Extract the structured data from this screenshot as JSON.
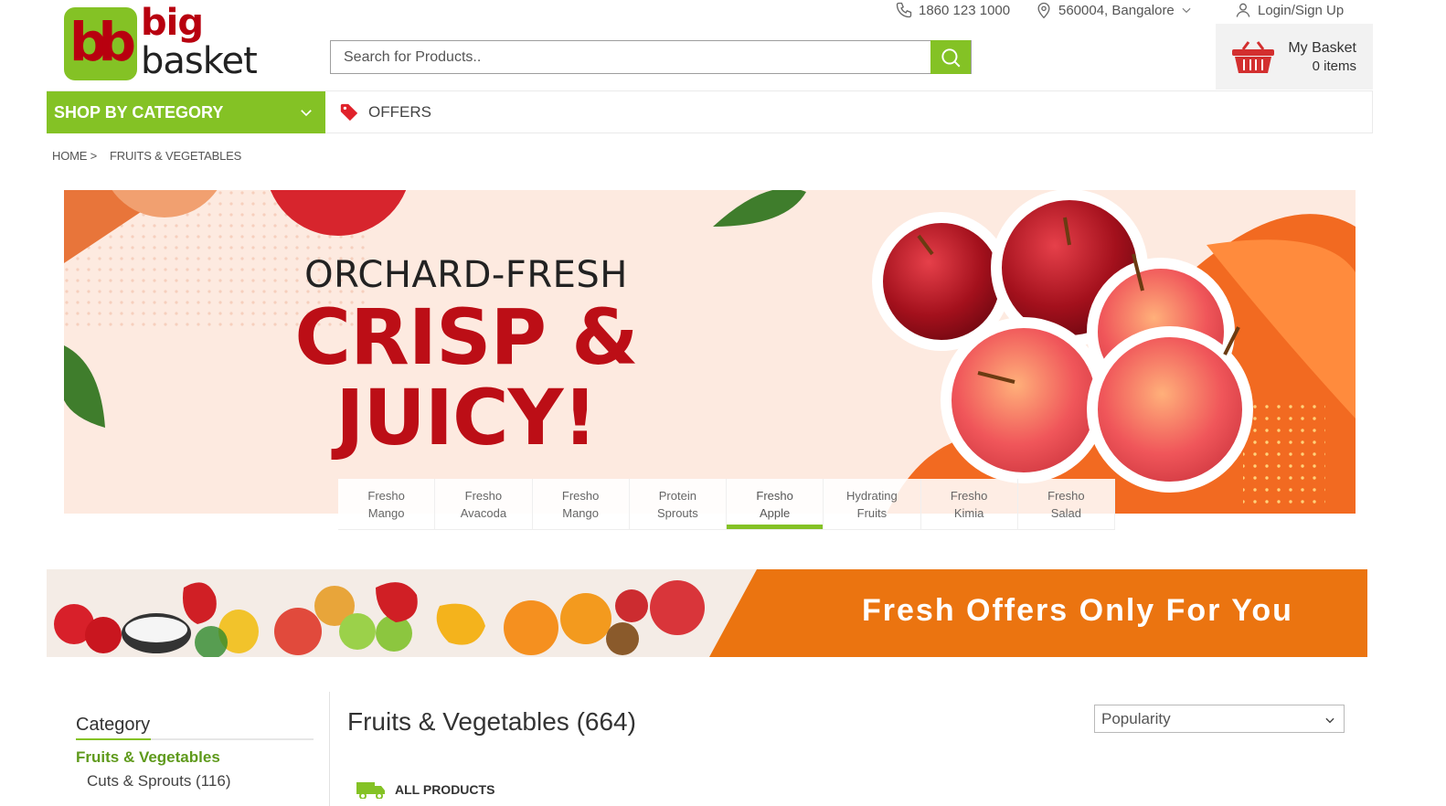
{
  "header": {
    "phone": "1860 123 1000",
    "location": "560004, Bangalore",
    "login": "Login/Sign Up",
    "logo_word1": "big",
    "logo_word2": "basket",
    "logo_mark": "bb",
    "search_placeholder": "Search for Products..",
    "basket_title": "My Basket",
    "basket_count": "0 items"
  },
  "nav": {
    "shop_by_category": "SHOP BY CATEGORY",
    "offers": "OFFERS"
  },
  "breadcrumb": [
    "HOME >",
    "FRUITS & VEGETABLES"
  ],
  "hero": {
    "line1": "ORCHARD-FRESH",
    "line2": "CRISP &",
    "line3": "JUICY!",
    "tabs": [
      {
        "l1": "Fresho",
        "l2": "Mango"
      },
      {
        "l1": "Fresho",
        "l2": "Avacoda"
      },
      {
        "l1": "Fresho",
        "l2": "Mango"
      },
      {
        "l1": "Protein",
        "l2": "Sprouts"
      },
      {
        "l1": "Fresho",
        "l2": "Apple"
      },
      {
        "l1": "Hydrating",
        "l2": "Fruits"
      },
      {
        "l1": "Fresho",
        "l2": "Kimia"
      },
      {
        "l1": "Fresho",
        "l2": "Salad"
      }
    ],
    "active_tab": 4
  },
  "strip": {
    "text": "Fresh Offers Only For You"
  },
  "sidebar": {
    "title": "Category",
    "category": "Fruits & Vegetables",
    "subcategory": "Cuts & Sprouts (116)"
  },
  "listing": {
    "title": "Fruits & Vegetables (664)",
    "sort_value": "Popularity",
    "all_products": "ALL PRODUCTS"
  },
  "colors": {
    "brand_green": "#84c225",
    "brand_red": "#b8000f",
    "offer_orange": "#eb7410"
  },
  "icons": [
    "phone-icon",
    "location-pin-icon",
    "user-icon",
    "search-icon",
    "basket-icon",
    "chevron-down-icon",
    "tag-icon",
    "truck-icon"
  ]
}
